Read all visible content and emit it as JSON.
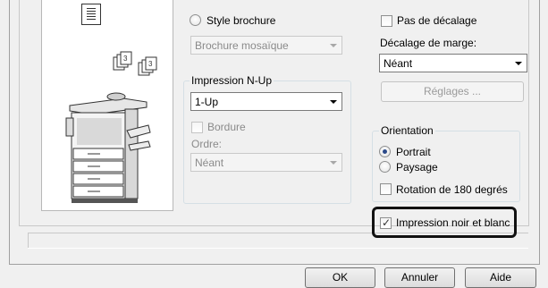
{
  "preview": {
    "document_icon": "document-icon",
    "pages_icon": "nup-pages-icon",
    "printer_icon": "printer-icon"
  },
  "brochure": {
    "style_label": "Style brochure",
    "style_selected": false,
    "type_value": "Brochure mosaïque",
    "enabled": false
  },
  "nup": {
    "group_title": "Impression N-Up",
    "value": "1-Up",
    "border_label": "Bordure",
    "border_checked": false,
    "order_label": "Ordre:",
    "order_value": "Néant"
  },
  "margin": {
    "no_shift_label": "Pas de décalage",
    "no_shift_checked": false,
    "shift_label": "Décalage de marge:",
    "shift_value": "Néant",
    "settings_button": "Réglages ..."
  },
  "orientation": {
    "group_title": "Orientation",
    "portrait_label": "Portrait",
    "landscape_label": "Paysage",
    "selected": "Portrait",
    "rotate_label": "Rotation de 180 degrés",
    "rotate_checked": false
  },
  "bw_print": {
    "label": "Impression noir et blanc",
    "checked": true
  },
  "footer": {
    "ok": "OK",
    "cancel": "Annuler",
    "help": "Aide"
  }
}
